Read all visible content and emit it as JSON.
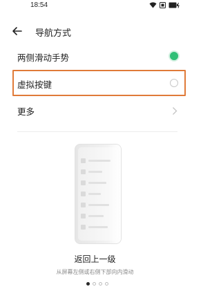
{
  "status_bar": {
    "time": "18:54",
    "icons": [
      "wifi-icon",
      "sim-icon",
      "battery-charging-icon"
    ]
  },
  "header": {
    "title": "导航方式",
    "back_icon": "back-arrow-icon"
  },
  "options": [
    {
      "label": "两侧滑动手势",
      "type": "radio",
      "selected": true
    },
    {
      "label": "虚拟按键",
      "type": "radio",
      "selected": false,
      "highlighted": true
    },
    {
      "label": "更多",
      "type": "link",
      "icon": "chevron-right-icon"
    }
  ],
  "preview": {
    "title": "返回上一级",
    "subtitle": "从屏幕左侧或右侧下部向内滑动",
    "page_count": 4,
    "current_page": 1
  },
  "colors": {
    "accent_green": "#2fbf76",
    "highlight_orange": "#e07a38"
  }
}
